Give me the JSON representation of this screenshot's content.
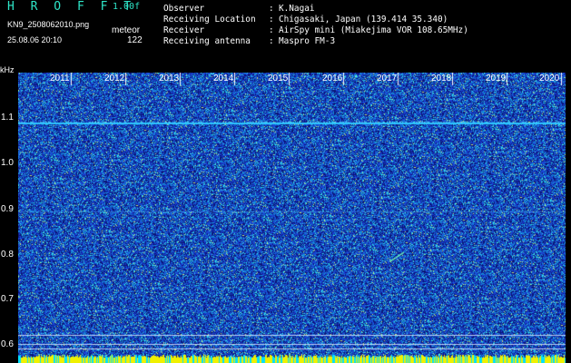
{
  "header": {
    "title": "H R O F F T",
    "version": "1.00f",
    "filename": "KN9_2508062010.png",
    "mode": "meteor",
    "datetime": "25.08.06 20:10",
    "count": "122"
  },
  "info": {
    "separator": ":",
    "rows": [
      {
        "label": "Observer",
        "value": "K.Nagai"
      },
      {
        "label": "Receiving Location",
        "value": "Chigasaki, Japan (139.414 35.340)"
      },
      {
        "label": "Receiver",
        "value": "AirSpy mini (Miakejima VOR 108.65MHz)"
      },
      {
        "label": "Receiving antenna",
        "value": "Maspro FM-3"
      }
    ]
  },
  "axis": {
    "unit": "kHz",
    "y_ticks": [
      "1.1",
      "1.0",
      "0.9",
      "0.8",
      "0.7",
      "0.6"
    ],
    "x_ticks": [
      "2011",
      "2012",
      "2013",
      "2014",
      "2015",
      "2016",
      "2017",
      "2018",
      "2019",
      "2020"
    ]
  },
  "colors": {
    "background": "#000000",
    "accent": "#2ee6c8",
    "spectrogram_base": "#1a2fa8",
    "carrier_line": "#2ec6ff",
    "bottom_band": "#f0f000"
  }
}
